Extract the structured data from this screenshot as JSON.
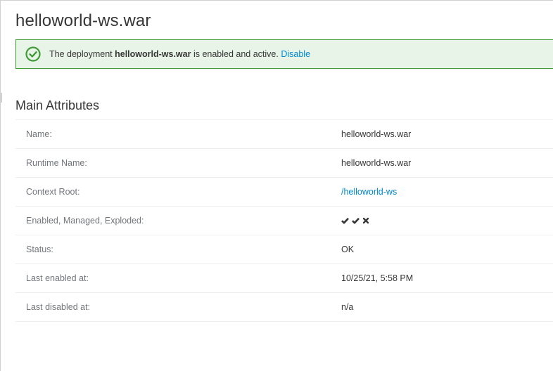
{
  "page": {
    "title": "helloworld-ws.war"
  },
  "alert": {
    "prefix": "The deployment ",
    "name": "helloworld-ws.war",
    "suffix": " is enabled and active.",
    "action": "Disable",
    "icon": "check-circle-icon",
    "color": "#3f9c35",
    "background": "#e9f4e9"
  },
  "main_attributes": {
    "title": "Main Attributes",
    "rows": [
      {
        "label": "Name:",
        "value": "helloworld-ws.war"
      },
      {
        "label": "Runtime Name:",
        "value": "helloworld-ws.war"
      },
      {
        "label": "Context Root:",
        "value": "/helloworld-ws"
      },
      {
        "label": "Enabled, Managed, Exploded:",
        "flags": [
          {
            "name": "enabled",
            "state": true,
            "icon": "check-icon"
          },
          {
            "name": "managed",
            "state": true,
            "icon": "check-icon"
          },
          {
            "name": "exploded",
            "state": false,
            "icon": "x-icon"
          }
        ]
      },
      {
        "label": "Status:",
        "value": "OK"
      },
      {
        "label": "Last enabled at:",
        "value": "10/25/21, 5:58 PM"
      },
      {
        "label": "Last disabled at:",
        "value": "n/a"
      }
    ]
  },
  "colors": {
    "link": "#0088ce",
    "text": "#363636",
    "label": "#72767b"
  }
}
